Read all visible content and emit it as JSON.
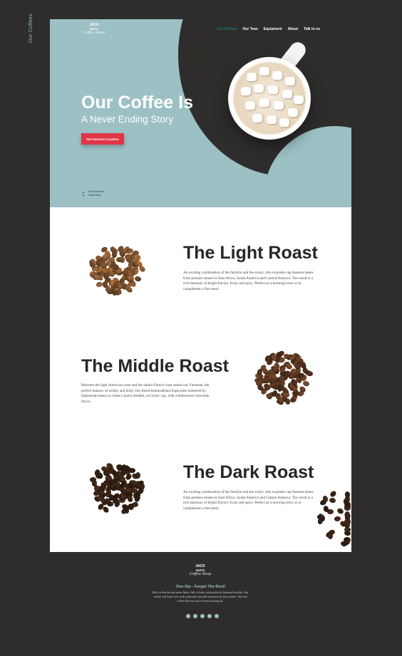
{
  "side_label": "Our Coffees",
  "brand": {
    "line1": "JACK",
    "line2": "SMITH",
    "line3": "Coffee Shop"
  },
  "nav": [
    {
      "label": "Our Coffees",
      "active": true
    },
    {
      "label": "Our Teas",
      "active": false
    },
    {
      "label": "Equipment",
      "active": false
    },
    {
      "label": "About",
      "active": false
    },
    {
      "label": "Talk to us",
      "active": false
    }
  ],
  "hero": {
    "title": "Our Coffee Is",
    "subtitle": "A Never Ending Story",
    "cta": "See Nearest Location",
    "scroll_line1": "Scroll Down to",
    "scroll_line2": "Learn More"
  },
  "roasts": [
    {
      "title": "The Light Roast",
      "description": "An exciting combination of the familiar and the exotic, this exquisite cup features beans from premier estates in East Africa, South America and Central America. The result is a rich harmony of bright flavors, fruity and spicy. Perfect as a morning brew or to compliment a fine meal."
    },
    {
      "title": "The Middle Roast",
      "description": "Between the light American roast and the darker French roast stands our Viennese; the perfect balance of acidity and body. Our blend featuresBlani Especiales bolstered by Indonesian beans to create a heavy-bodied, yet lively cup, with a bittersweet chocolate flavor."
    },
    {
      "title": "The Dark Roast",
      "description": "An exciting combination of the familiar and the exotic, this exquisite cup features beans from premier estates in East Africa, South America and Central America. The result is a rich harmony of bright flavors, fruity and spicy. Perfect as a morning brew or to compliment a fine meal."
    }
  ],
  "footer": {
    "tagline": "One Sip - Forget The Rest!",
    "description": "Rich in flavour but never bitter, full of body with perfectly balanced acidity. Our coffee will leave you with a pleasant smooth sensation in your palate - the real coffee flavour you've been looking for.",
    "social_count": 5
  },
  "colors": {
    "teal": "#9cc0c4",
    "dark": "#2f2d2c",
    "accent": "#e13548"
  }
}
